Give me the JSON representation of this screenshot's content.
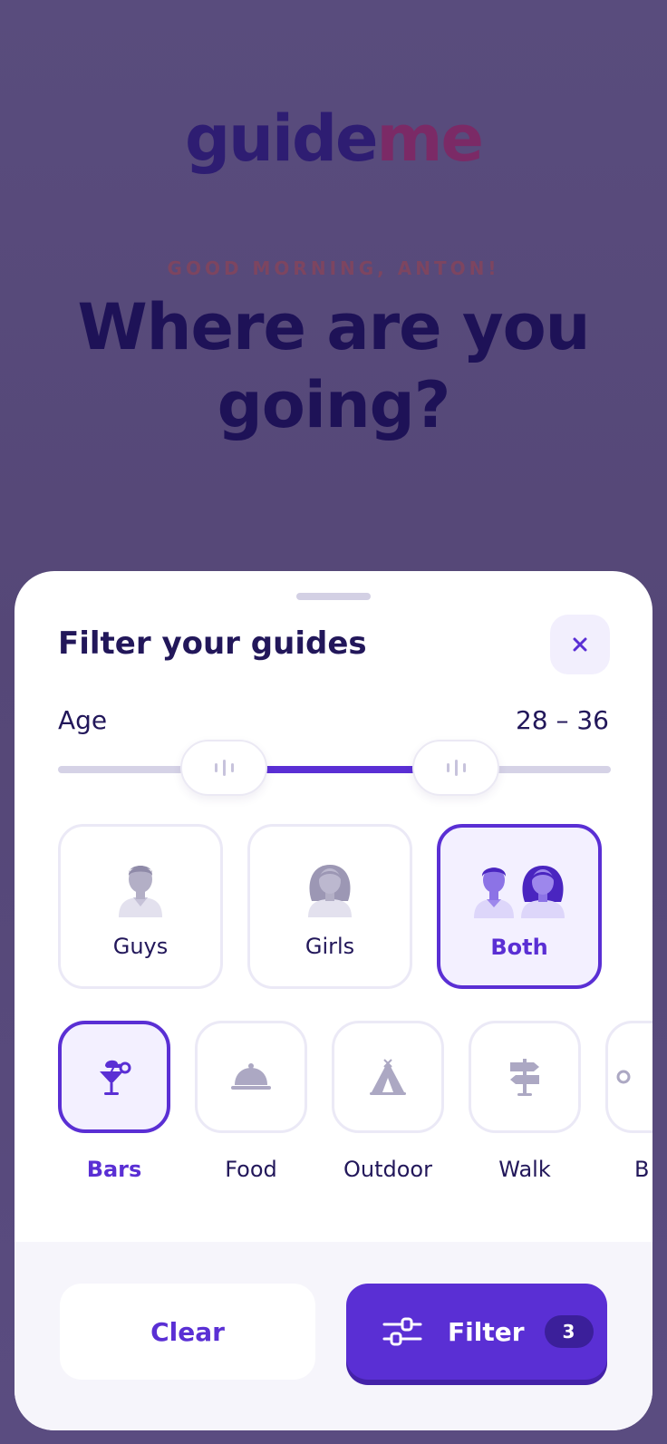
{
  "colors": {
    "accent": "#5a2fd4",
    "logo_guide": "#2e1d72",
    "logo_me": "#7b2a66",
    "backdrop": "#574a7a"
  },
  "logo": {
    "part1": "guide",
    "part2": "me"
  },
  "greeting": "GOOD MORNING, ANTON!",
  "headline": "Where are you going?",
  "filter": {
    "title": "Filter your guides",
    "close_icon": "close-icon",
    "age": {
      "label": "Age",
      "value": "28 – 36",
      "range_min_fraction": 0.3,
      "range_max_fraction": 0.72
    },
    "gender": {
      "options": [
        {
          "label": "Guys",
          "icon": "man-icon"
        },
        {
          "label": "Girls",
          "icon": "woman-icon"
        },
        {
          "label": "Both",
          "icon": "couple-icon"
        }
      ],
      "selected": "Both"
    },
    "categories": {
      "items": [
        {
          "label": "Bars",
          "icon": "cocktail-icon"
        },
        {
          "label": "Food",
          "icon": "cloche-icon"
        },
        {
          "label": "Outdoor",
          "icon": "tent-icon"
        },
        {
          "label": "Walk",
          "icon": "signpost-icon"
        },
        {
          "label": "B",
          "icon": "more-icon"
        }
      ],
      "selected": "Bars"
    },
    "actions": {
      "clear_label": "Clear",
      "filter_label": "Filter",
      "filter_count": "3"
    }
  }
}
